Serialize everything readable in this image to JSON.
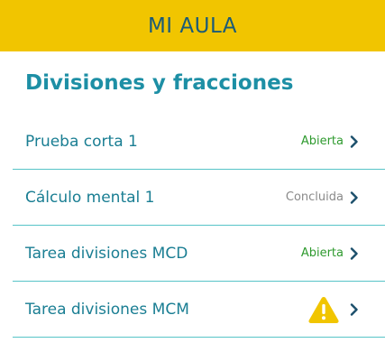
{
  "header": {
    "title": "MI AULA"
  },
  "section": {
    "title": "Divisiones y fracciones"
  },
  "items": [
    {
      "title": "Prueba corta 1",
      "status": "Abierta",
      "status_type": "open",
      "icon": "chevron-right-icon"
    },
    {
      "title": "Cálculo mental 1",
      "status": "Concluida",
      "status_type": "done",
      "icon": "chevron-right-icon"
    },
    {
      "title": "Tarea divisiones MCD",
      "status": "Abierta",
      "status_type": "open",
      "icon": "chevron-right-icon"
    },
    {
      "title": "Tarea divisiones MCM",
      "status": "",
      "status_type": "warning",
      "status_icon": "warning-icon",
      "icon": "chevron-right-icon"
    }
  ],
  "colors": {
    "header_bg": "#f1c500",
    "header_text": "#1b5b78",
    "accent": "#1d8fa5",
    "divider": "#57c4c8",
    "status_open": "#2e9a2e",
    "status_done": "#8a8a8a",
    "warning": "#f1c500"
  }
}
